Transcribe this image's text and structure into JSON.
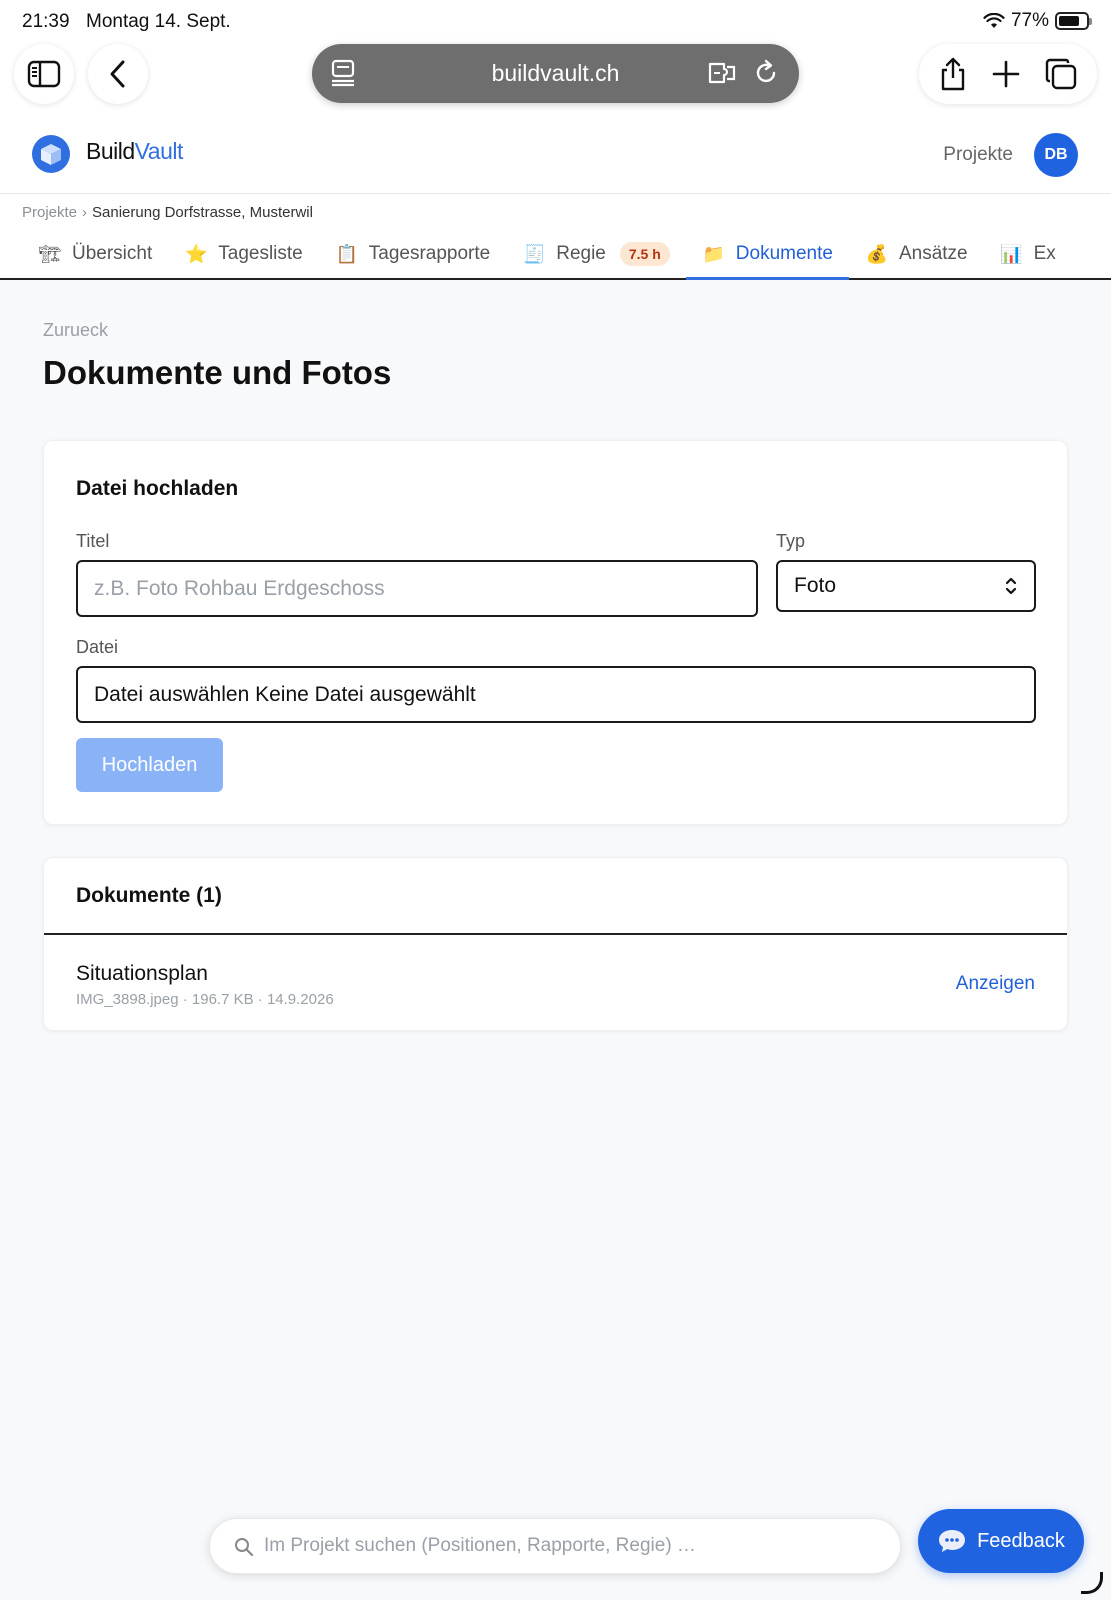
{
  "status": {
    "time": "21:39",
    "date": "Montag 14. Sept.",
    "battery": "77%",
    "battery_level": 0.77
  },
  "browser": {
    "url": "buildvault.ch"
  },
  "app": {
    "brand_part1": "Build",
    "brand_part2": "Vault",
    "nav_projects": "Projekte",
    "avatar_initials": "DB",
    "accent_color": "#2f6fe0"
  },
  "breadcrumb": {
    "root": "Projekte",
    "separator": "›",
    "current": "Sanierung Dorfstrasse, Musterwil"
  },
  "tabs": [
    {
      "label": "Übersicht",
      "icon": "crane-icon",
      "glyph": "🏗"
    },
    {
      "label": "Tagesliste",
      "icon": "star-icon",
      "glyph": "⭐"
    },
    {
      "label": "Tagesrapporte",
      "icon": "clipboard-icon",
      "glyph": "📋"
    },
    {
      "label": "Regie",
      "icon": "receipt-icon",
      "glyph": "🧾",
      "badge": "7.5 h"
    },
    {
      "label": "Dokumente",
      "icon": "folder-icon",
      "glyph": "📁",
      "active": true
    },
    {
      "label": "Ansätze",
      "icon": "money-bag-icon",
      "glyph": "💰"
    },
    {
      "label": "Ex",
      "icon": "chart-icon",
      "glyph": "📊"
    }
  ],
  "page": {
    "back_label": "Zurueck",
    "title": "Dokumente und Fotos"
  },
  "upload": {
    "heading": "Datei hochladen",
    "title_label": "Titel",
    "title_placeholder": "z.B. Foto Rohbau Erdgeschoss",
    "type_label": "Typ",
    "type_value": "Foto",
    "file_label": "Datei",
    "file_value": "Datei auswählen Keine Datei ausgewählt",
    "submit_label": "Hochladen"
  },
  "documents": {
    "heading": "Dokumente (1)",
    "items": [
      {
        "name": "Situationsplan",
        "meta": "IMG_3898.jpeg · 196.7 KB · 14.9.2026",
        "action": "Anzeigen"
      }
    ]
  },
  "search": {
    "placeholder": "Im Projekt suchen (Positionen, Rapporte, Regie) …"
  },
  "feedback": {
    "label": "Feedback"
  }
}
